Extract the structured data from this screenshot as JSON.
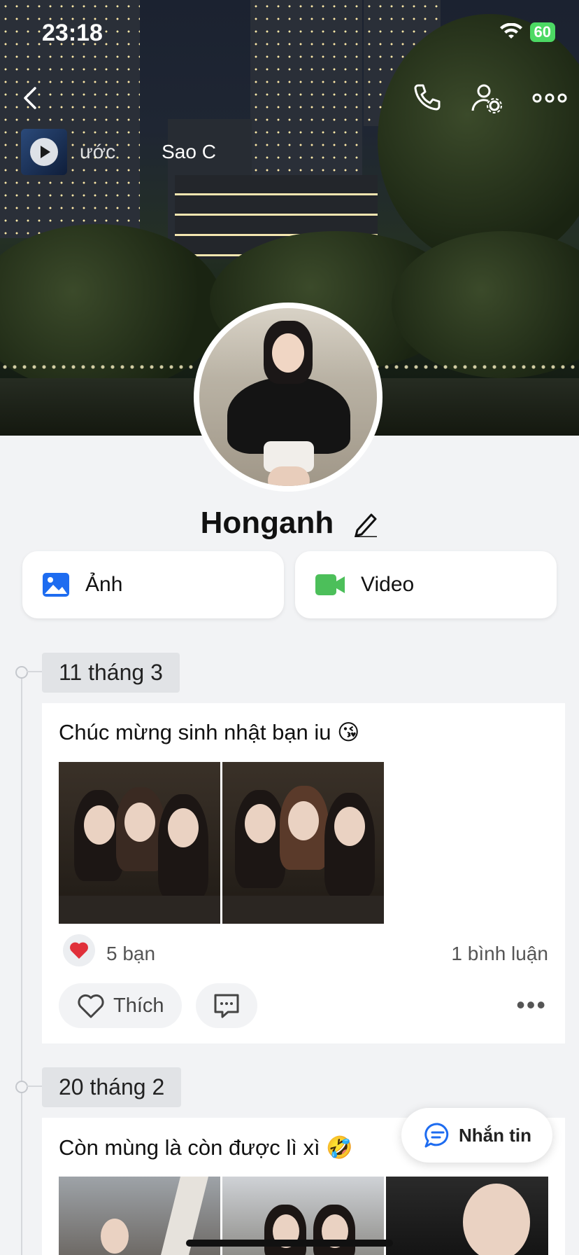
{
  "status": {
    "time": "23:18",
    "battery": "60"
  },
  "music": {
    "tracks": [
      "ước",
      "Sao C"
    ]
  },
  "profile": {
    "name": "Honganh"
  },
  "actions": {
    "photos": "Ảnh",
    "videos": "Video"
  },
  "posts": [
    {
      "date": "11 tháng 3",
      "text": "Chúc mừng sinh nhật bạn iu 😘",
      "reactions": "5 bạn",
      "comments": "1 bình luận",
      "like_label": "Thích"
    },
    {
      "date": "20 tháng 2",
      "text": "Còn mùng là còn được lì xì 🤣"
    }
  ],
  "fab": {
    "label": "Nhắn tin"
  },
  "colors": {
    "accent": "#1e6cf0",
    "like_heart": "#e0303a",
    "video_green": "#4cbf5a",
    "photo_blue": "#1e6cf0"
  }
}
